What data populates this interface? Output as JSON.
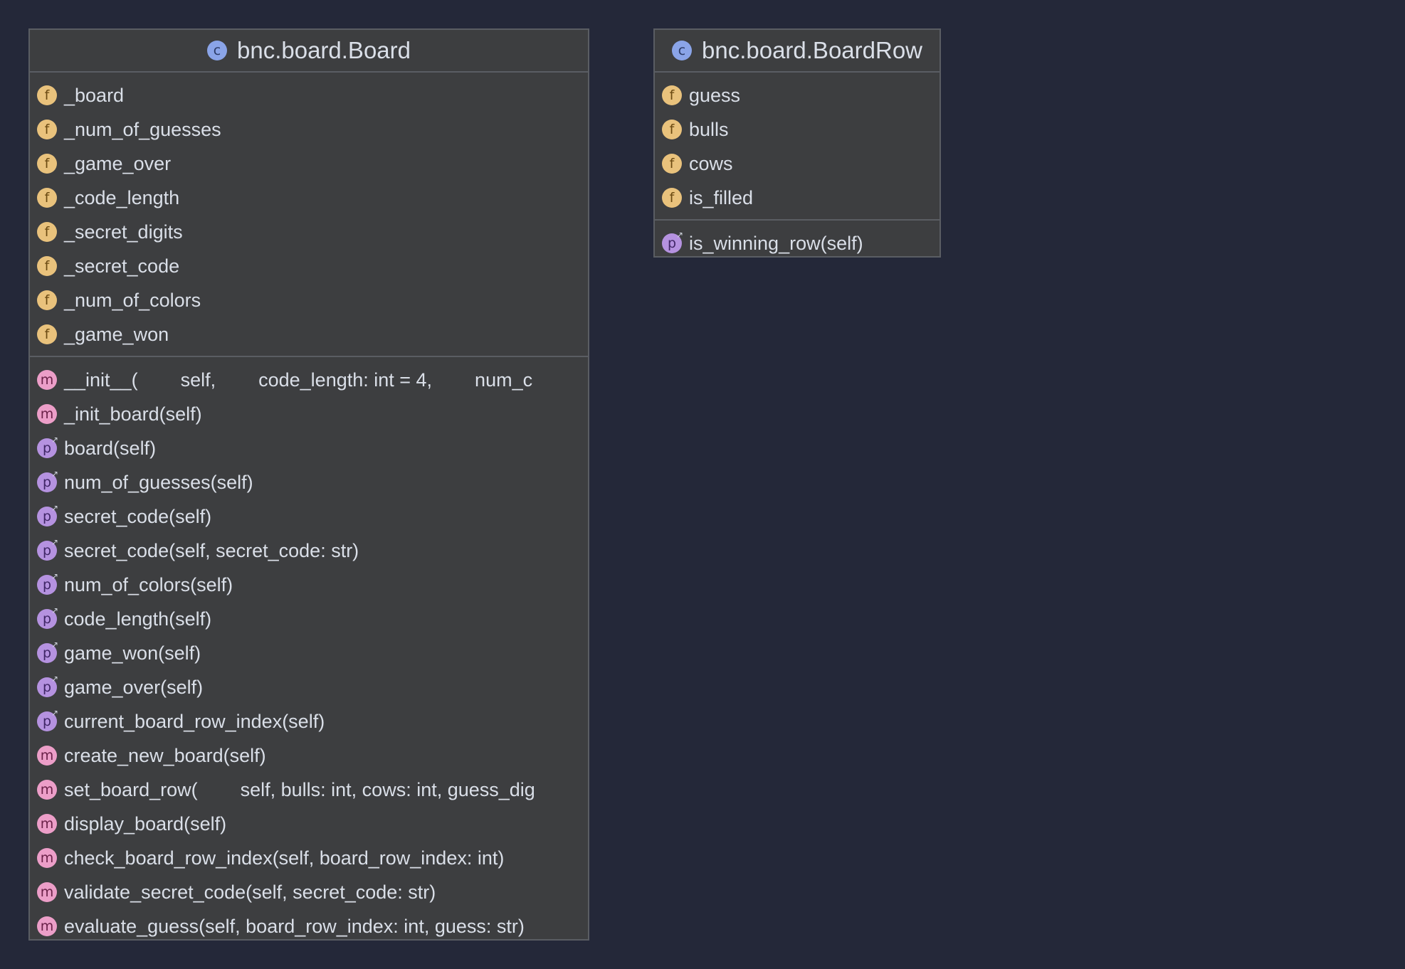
{
  "diagram": {
    "classes": [
      {
        "name": "bnc.board.Board",
        "icon": "class-icon",
        "fields": [
          {
            "name": "_board",
            "icon": "field-icon"
          },
          {
            "name": "_num_of_guesses",
            "icon": "field-icon"
          },
          {
            "name": "_game_over",
            "icon": "field-icon"
          },
          {
            "name": "_code_length",
            "icon": "field-icon"
          },
          {
            "name": "_secret_digits",
            "icon": "field-icon"
          },
          {
            "name": "_secret_code",
            "icon": "field-icon"
          },
          {
            "name": "_num_of_colors",
            "icon": "field-icon"
          },
          {
            "name": "_game_won",
            "icon": "field-icon"
          }
        ],
        "members": [
          {
            "name": "__init__(        self,        code_length: int = 4,        num_c",
            "kind": "method"
          },
          {
            "name": "_init_board(self)",
            "kind": "method"
          },
          {
            "name": "board(self)",
            "kind": "property"
          },
          {
            "name": "num_of_guesses(self)",
            "kind": "property"
          },
          {
            "name": "secret_code(self)",
            "kind": "property"
          },
          {
            "name": "secret_code(self, secret_code: str)",
            "kind": "property"
          },
          {
            "name": "num_of_colors(self)",
            "kind": "property"
          },
          {
            "name": "code_length(self)",
            "kind": "property"
          },
          {
            "name": "game_won(self)",
            "kind": "property"
          },
          {
            "name": "game_over(self)",
            "kind": "property"
          },
          {
            "name": "current_board_row_index(self)",
            "kind": "property"
          },
          {
            "name": "create_new_board(self)",
            "kind": "method"
          },
          {
            "name": "set_board_row(        self, bulls: int, cows: int, guess_dig",
            "kind": "method"
          },
          {
            "name": "display_board(self)",
            "kind": "method"
          },
          {
            "name": "check_board_row_index(self, board_row_index: int)",
            "kind": "method"
          },
          {
            "name": "validate_secret_code(self, secret_code: str)",
            "kind": "method"
          },
          {
            "name": "evaluate_guess(self, board_row_index: int, guess: str)",
            "kind": "method"
          }
        ]
      },
      {
        "name": "bnc.board.BoardRow",
        "icon": "class-icon",
        "fields": [
          {
            "name": "guess",
            "icon": "field-icon"
          },
          {
            "name": "bulls",
            "icon": "field-icon"
          },
          {
            "name": "cows",
            "icon": "field-icon"
          },
          {
            "name": "is_filled",
            "icon": "field-icon"
          }
        ],
        "members": [
          {
            "name": "is_winning_row(self)",
            "kind": "property"
          }
        ]
      }
    ],
    "icon_letters": {
      "class": "c",
      "field": "f",
      "method": "m",
      "property": "p",
      "property_marker": "↗"
    },
    "colors": {
      "background": "#242839",
      "box": "#3d3e40",
      "border": "#5a5d63",
      "class_icon": "#8aa4e8",
      "field_icon": "#e9c27c",
      "method_icon": "#ec9ec8",
      "property_icon": "#b592e0"
    }
  }
}
